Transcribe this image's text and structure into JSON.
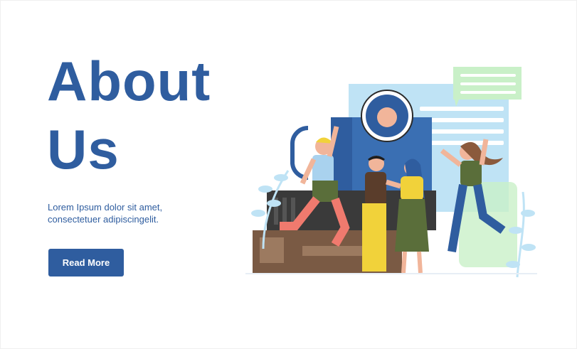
{
  "hero": {
    "title_line1": "About",
    "title_line2": "Us",
    "description_line1": "Lorem Ipsum dolor sit amet,",
    "description_line2": "consectetuer adipiscingelit.",
    "cta_label": "Read More"
  },
  "colors": {
    "brand_blue": "#2f5d9f",
    "background": "#ffffff",
    "light_blue": "#bfe3f5",
    "light_green": "#c9f0c8",
    "brown": "#7a5a44",
    "dark_gray": "#3a3a3a",
    "olive": "#5a6e3a",
    "yellow": "#f1d23a"
  },
  "illustration": {
    "name": "team-celebration-illustration"
  }
}
